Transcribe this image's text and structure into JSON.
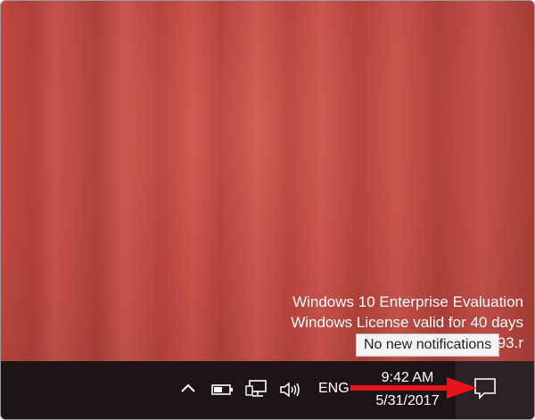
{
  "desktop": {
    "watermark_lines": [
      "Windows 10 Enterprise Evaluation",
      "Windows License valid for 40 days",
      "Build 14393.r"
    ]
  },
  "taskbar": {
    "icons": [
      "chevron-up-icon",
      "battery-icon",
      "network-icon",
      "volume-icon",
      "action-center-icon"
    ],
    "language": "ENG",
    "time": "9:42 AM",
    "date": "5/31/2017"
  },
  "tooltip": {
    "text": "No new notifications"
  },
  "annotation": {
    "arrow_color": "#e8141b"
  },
  "colors": {
    "desktop": "#c64b42",
    "taskbar": "#1d1416",
    "action_center_bg": "#2c2225"
  }
}
